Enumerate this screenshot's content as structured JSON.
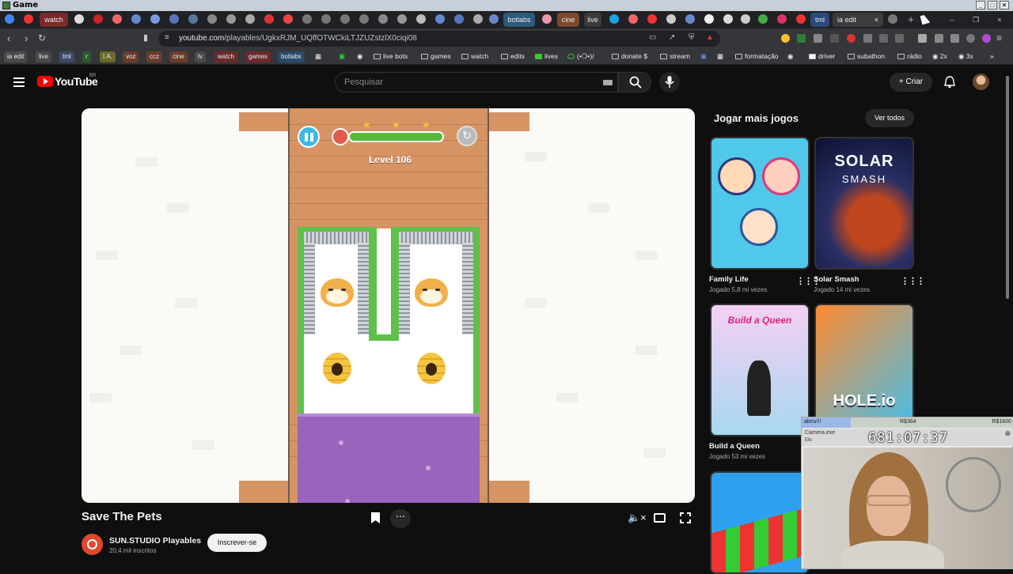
{
  "window": {
    "title": "Game"
  },
  "tabs": [
    {
      "label": "watch",
      "bg": "#7b2a2a"
    },
    {
      "label": "botlabs",
      "bg": "#2b5a7b"
    },
    {
      "label": "cine",
      "bg": "#7b4a2a"
    },
    {
      "label": "live",
      "bg": "#3a3a3a"
    },
    {
      "label": "tml",
      "bg": "#2b4a7b"
    },
    {
      "label": "ia edit",
      "bg": "#3c3c3c"
    }
  ],
  "address": {
    "host": "youtube.com",
    "path": "/playables/UgkxRJM_UQffOTWCkiLTJZUZstzlX0ciqi08"
  },
  "bookmark_chips": [
    {
      "label": "ia edit",
      "color": "#4a4a4a"
    },
    {
      "label": "live",
      "color": "#4a4a4a"
    },
    {
      "label": "tml",
      "color": "#3c4a6b"
    },
    {
      "label": "r",
      "color": "#2e5a2e"
    },
    {
      "label": "I.A.",
      "color": "#6b6b2a"
    },
    {
      "label": "voz",
      "color": "#6b3c2a"
    },
    {
      "label": "ccz",
      "color": "#6b3c2a"
    },
    {
      "label": "cine",
      "color": "#6b3c2a"
    },
    {
      "label": "lv",
      "color": "#4a4a4a"
    },
    {
      "label": "watch",
      "color": "#6b2a2a"
    },
    {
      "label": "games",
      "color": "#6b2a2a"
    },
    {
      "label": "botlabs",
      "color": "#2a4a6b"
    }
  ],
  "bookmarks": [
    "live bots",
    "games",
    "watch",
    "edits",
    "lives",
    "(•❍•)/",
    "donate $",
    "stream",
    "formatação",
    "driver",
    "subathon",
    "rádio",
    "2x",
    "3x"
  ],
  "youtube": {
    "logo_text": "YouTube",
    "region": "BR",
    "search_placeholder": "Pesquisar",
    "create_label": "Criar"
  },
  "game": {
    "level_label": "Level 106",
    "progress": 1.0,
    "stars": 3
  },
  "video": {
    "title": "Save The Pets",
    "channel": "SUN.STUDIO Playables",
    "subscribers": "20,4 mil inscritos",
    "subscribe_label": "Inscrever-se"
  },
  "sidebar": {
    "title": "Jogar mais jogos",
    "see_all": "Ver todos",
    "games": [
      {
        "title": "Family Life",
        "meta": "Jogado 5,8 mi vezes",
        "thumb_bg": "#4fc8ea"
      },
      {
        "title": "Solar Smash",
        "meta": "Jogado 14 mi vezes",
        "thumb_bg": "#1a1f4a",
        "thumb_text": "SOLAR",
        "thumb_sub": "SMASH"
      },
      {
        "title": "Build a Queen",
        "meta": "Jogado 53 mi vezes",
        "thumb_bg": "#e0c8f0",
        "thumb_text": "Build a Queen"
      },
      {
        "title": "",
        "meta": "",
        "thumb_bg": "#4fa8e8",
        "thumb_text": "HOLE.io"
      },
      {
        "title": "",
        "meta": "",
        "thumb_bg": "#2fa0f0"
      }
    ]
  },
  "overlay": {
    "goal_label": "abriu!!!",
    "goal_mid": "R$364",
    "goal_max": "R$1600",
    "goal_progress": 0.23,
    "camera_label": "Camera.exe",
    "camera_sub": "Elo",
    "timer": "681:07:37"
  }
}
